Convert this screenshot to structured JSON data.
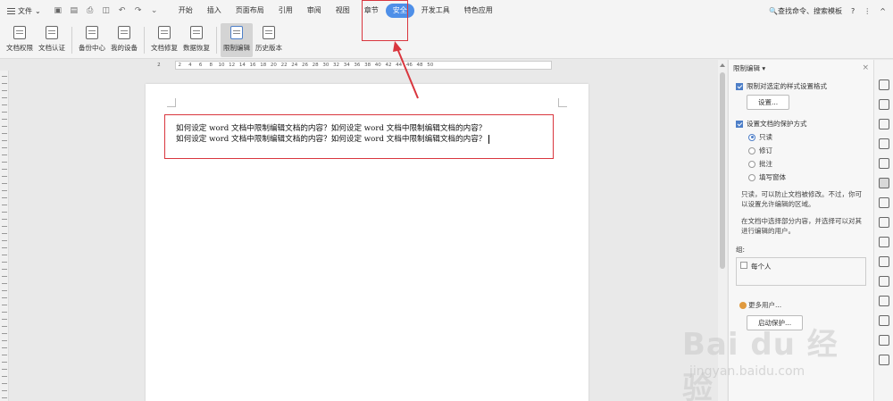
{
  "menubar": {
    "file_label": "文件",
    "tabs": [
      {
        "label": "开始",
        "active": false
      },
      {
        "label": "插入",
        "active": false
      },
      {
        "label": "页面布局",
        "active": false
      },
      {
        "label": "引用",
        "active": false
      },
      {
        "label": "审阅",
        "active": false
      },
      {
        "label": "视图",
        "active": false
      },
      {
        "label": "章节",
        "active": false
      },
      {
        "label": "安全",
        "active": true
      },
      {
        "label": "开发工具",
        "active": false
      },
      {
        "label": "特色应用",
        "active": false
      }
    ],
    "search_label": "查找命令、搜索模板",
    "help_glyph": "?",
    "more_glyph": "⋮",
    "collapse_glyph": "^",
    "active_tab_color": "#4e8fe8"
  },
  "ribbon": {
    "buttons": [
      {
        "label": "文档权限",
        "active": false
      },
      {
        "label": "文档认证",
        "active": false
      },
      {
        "label": "备份中心",
        "active": false
      },
      {
        "label": "我的设备",
        "active": false
      },
      {
        "label": "文档修复",
        "active": false
      },
      {
        "label": "数据恢复",
        "active": false
      },
      {
        "label": "限制编辑",
        "active": true
      },
      {
        "label": "历史版本",
        "active": false
      }
    ]
  },
  "ruler": {
    "numbers": [
      "2",
      "",
      "2",
      "4",
      "6",
      "8",
      "10",
      "12",
      "14",
      "16",
      "18",
      "20",
      "22",
      "24",
      "26",
      "28",
      "30",
      "32",
      "34",
      "36",
      "38",
      "40",
      "42",
      "44",
      "46",
      "48",
      "50"
    ]
  },
  "document": {
    "lines": [
      "如何设定 word 文档中限制编辑文档的内容？如何设定 word 文档中限制编辑文档的内容？",
      "如何设定 word 文档中限制编辑文档的内容？如何设定 word 文档中限制编辑文档的内容？"
    ]
  },
  "panel": {
    "title": "限制编辑 ▾",
    "close_glyph": "×",
    "format_restrict_label": "限制对选定的样式设置格式",
    "settings_button": "设置...",
    "protect_label": "设置文档的保护方式",
    "options": [
      {
        "label": "只读",
        "selected": true
      },
      {
        "label": "修订",
        "selected": false
      },
      {
        "label": "批注",
        "selected": false
      },
      {
        "label": "填写窗体",
        "selected": false
      }
    ],
    "readonly_desc": "只读，可以防止文档被修改。不过，你可以设置允许编辑的区域。",
    "selection_desc": "在文档中选择部分内容，并选择可以对其进行编辑的用户。",
    "group_label": "组:",
    "everyone_label": "每个人",
    "more_users_label": "更多用户...",
    "start_button": "启动保护..."
  },
  "watermark": {
    "main": "Bai du 经验",
    "sub": "jingyan.baidu.com"
  },
  "annotation_color": "#d9363e"
}
